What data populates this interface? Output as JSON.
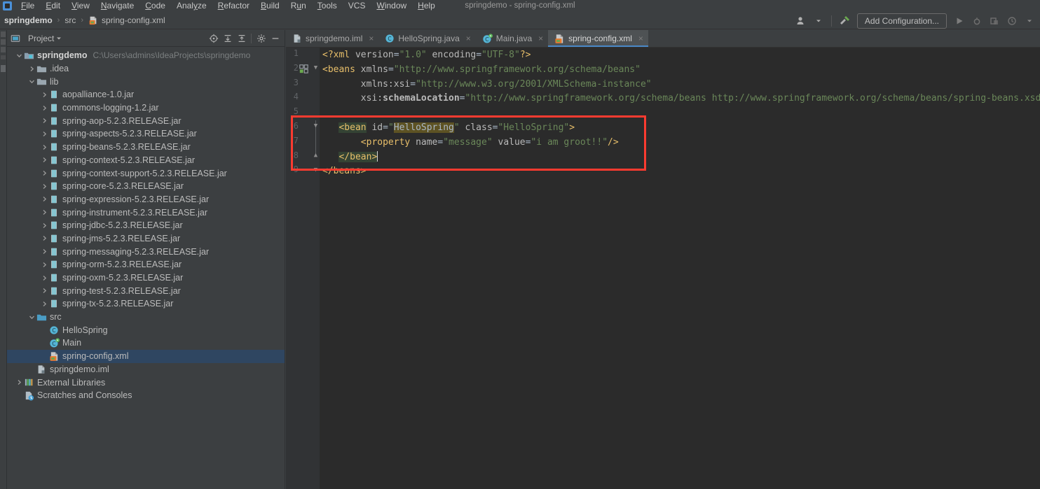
{
  "window": {
    "title": "springdemo - spring-config.xml"
  },
  "menu": {
    "items": [
      {
        "label": "File",
        "mnemonic": "F"
      },
      {
        "label": "Edit",
        "mnemonic": "E"
      },
      {
        "label": "View",
        "mnemonic": "V"
      },
      {
        "label": "Navigate",
        "mnemonic": "N"
      },
      {
        "label": "Code",
        "mnemonic": "C"
      },
      {
        "label": "Analyze",
        "mnemonic": "y"
      },
      {
        "label": "Refactor",
        "mnemonic": "R"
      },
      {
        "label": "Build",
        "mnemonic": "B"
      },
      {
        "label": "Run",
        "mnemonic": "u"
      },
      {
        "label": "Tools",
        "mnemonic": "T"
      },
      {
        "label": "VCS",
        "mnemonic": ""
      },
      {
        "label": "Window",
        "mnemonic": "W"
      },
      {
        "label": "Help",
        "mnemonic": "H"
      }
    ]
  },
  "navbar": {
    "crumbs": [
      {
        "label": "springdemo",
        "icon": ""
      },
      {
        "label": "src",
        "icon": ""
      },
      {
        "label": "spring-config.xml",
        "icon": "xml-file-icon"
      }
    ],
    "separator": "›"
  },
  "toolbar": {
    "user_icon": "user-avatar-icon",
    "hammer_icon": "build-hammer-icon",
    "run_config_label": "Add Configuration...",
    "run_icon": "run-icon",
    "debug_icon": "debug-icon",
    "coverage_icon": "run-with-coverage-icon",
    "profile_icon": "profile-icon",
    "more_icon": "chevron-down-icon"
  },
  "project_panel": {
    "title": "Project",
    "title_icon": "project-view-icon",
    "dropdown_icon": "chevron-down-icon",
    "header_buttons": [
      {
        "name": "scroll-from-source-icon"
      },
      {
        "name": "expand-all-icon"
      },
      {
        "name": "collapse-all-icon"
      },
      {
        "name": "settings-gear-icon"
      },
      {
        "name": "hide-panel-icon"
      }
    ],
    "tree": [
      {
        "label": "springdemo",
        "path": "C:\\Users\\admins\\IdeaProjects\\springdemo",
        "icon": "module-icon",
        "indent": 0,
        "arrow": "expanded",
        "bold": true,
        "selected": false
      },
      {
        "label": ".idea",
        "path": "",
        "icon": "folder-icon",
        "indent": 1,
        "arrow": "collapsed",
        "bold": false,
        "selected": false
      },
      {
        "label": "lib",
        "path": "",
        "icon": "folder-icon",
        "indent": 1,
        "arrow": "expanded",
        "bold": false,
        "selected": false
      },
      {
        "label": "aopalliance-1.0.jar",
        "path": "",
        "icon": "jar-icon",
        "indent": 2,
        "arrow": "collapsed",
        "bold": false,
        "selected": false
      },
      {
        "label": "commons-logging-1.2.jar",
        "path": "",
        "icon": "jar-icon",
        "indent": 2,
        "arrow": "collapsed",
        "bold": false,
        "selected": false
      },
      {
        "label": "spring-aop-5.2.3.RELEASE.jar",
        "path": "",
        "icon": "jar-icon",
        "indent": 2,
        "arrow": "collapsed",
        "bold": false,
        "selected": false
      },
      {
        "label": "spring-aspects-5.2.3.RELEASE.jar",
        "path": "",
        "icon": "jar-icon",
        "indent": 2,
        "arrow": "collapsed",
        "bold": false,
        "selected": false
      },
      {
        "label": "spring-beans-5.2.3.RELEASE.jar",
        "path": "",
        "icon": "jar-icon",
        "indent": 2,
        "arrow": "collapsed",
        "bold": false,
        "selected": false
      },
      {
        "label": "spring-context-5.2.3.RELEASE.jar",
        "path": "",
        "icon": "jar-icon",
        "indent": 2,
        "arrow": "collapsed",
        "bold": false,
        "selected": false
      },
      {
        "label": "spring-context-support-5.2.3.RELEASE.jar",
        "path": "",
        "icon": "jar-icon",
        "indent": 2,
        "arrow": "collapsed",
        "bold": false,
        "selected": false
      },
      {
        "label": "spring-core-5.2.3.RELEASE.jar",
        "path": "",
        "icon": "jar-icon",
        "indent": 2,
        "arrow": "collapsed",
        "bold": false,
        "selected": false
      },
      {
        "label": "spring-expression-5.2.3.RELEASE.jar",
        "path": "",
        "icon": "jar-icon",
        "indent": 2,
        "arrow": "collapsed",
        "bold": false,
        "selected": false
      },
      {
        "label": "spring-instrument-5.2.3.RELEASE.jar",
        "path": "",
        "icon": "jar-icon",
        "indent": 2,
        "arrow": "collapsed",
        "bold": false,
        "selected": false
      },
      {
        "label": "spring-jdbc-5.2.3.RELEASE.jar",
        "path": "",
        "icon": "jar-icon",
        "indent": 2,
        "arrow": "collapsed",
        "bold": false,
        "selected": false
      },
      {
        "label": "spring-jms-5.2.3.RELEASE.jar",
        "path": "",
        "icon": "jar-icon",
        "indent": 2,
        "arrow": "collapsed",
        "bold": false,
        "selected": false
      },
      {
        "label": "spring-messaging-5.2.3.RELEASE.jar",
        "path": "",
        "icon": "jar-icon",
        "indent": 2,
        "arrow": "collapsed",
        "bold": false,
        "selected": false
      },
      {
        "label": "spring-orm-5.2.3.RELEASE.jar",
        "path": "",
        "icon": "jar-icon",
        "indent": 2,
        "arrow": "collapsed",
        "bold": false,
        "selected": false
      },
      {
        "label": "spring-oxm-5.2.3.RELEASE.jar",
        "path": "",
        "icon": "jar-icon",
        "indent": 2,
        "arrow": "collapsed",
        "bold": false,
        "selected": false
      },
      {
        "label": "spring-test-5.2.3.RELEASE.jar",
        "path": "",
        "icon": "jar-icon",
        "indent": 2,
        "arrow": "collapsed",
        "bold": false,
        "selected": false
      },
      {
        "label": "spring-tx-5.2.3.RELEASE.jar",
        "path": "",
        "icon": "jar-icon",
        "indent": 2,
        "arrow": "collapsed",
        "bold": false,
        "selected": false
      },
      {
        "label": "src",
        "path": "",
        "icon": "source-folder-icon",
        "indent": 1,
        "arrow": "expanded",
        "bold": false,
        "selected": false
      },
      {
        "label": "HelloSpring",
        "path": "",
        "icon": "java-class-icon",
        "indent": 2,
        "arrow": "none",
        "bold": false,
        "selected": false
      },
      {
        "label": "Main",
        "path": "",
        "icon": "java-main-class-icon",
        "indent": 2,
        "arrow": "none",
        "bold": false,
        "selected": false
      },
      {
        "label": "spring-config.xml",
        "path": "",
        "icon": "xml-file-icon",
        "indent": 2,
        "arrow": "none",
        "bold": false,
        "selected": true
      },
      {
        "label": "springdemo.iml",
        "path": "",
        "icon": "iml-file-icon",
        "indent": 1,
        "arrow": "none",
        "bold": false,
        "selected": false
      },
      {
        "label": "External Libraries",
        "path": "",
        "icon": "libraries-icon",
        "indent": 0,
        "arrow": "collapsed",
        "bold": false,
        "selected": false
      },
      {
        "label": "Scratches and Consoles",
        "path": "",
        "icon": "scratches-icon",
        "indent": 0,
        "arrow": "none",
        "bold": false,
        "selected": false
      }
    ]
  },
  "editor": {
    "tabs": [
      {
        "label": "springdemo.iml",
        "icon": "iml-file-icon",
        "active": false
      },
      {
        "label": "HelloSpring.java",
        "icon": "java-class-icon",
        "active": false
      },
      {
        "label": "Main.java",
        "icon": "java-main-class-icon",
        "active": false
      },
      {
        "label": "spring-config.xml",
        "icon": "xml-file-icon",
        "active": true
      }
    ],
    "close_glyph": "×",
    "line_numbers": [
      "1",
      "2",
      "3",
      "4",
      "5",
      "6",
      "7",
      "8",
      "9"
    ],
    "lines": [
      {
        "n": 1,
        "segments": [
          {
            "t": "<?xml ",
            "c": "tag"
          },
          {
            "t": "version",
            "c": "attr"
          },
          {
            "t": "=",
            "c": "punct"
          },
          {
            "t": "\"1.0\"",
            "c": "str"
          },
          {
            "t": " encoding",
            "c": "attr"
          },
          {
            "t": "=",
            "c": "punct"
          },
          {
            "t": "\"UTF-8\"",
            "c": "str"
          },
          {
            "t": "?>",
            "c": "tag"
          }
        ]
      },
      {
        "n": 2,
        "segments": [
          {
            "t": "<beans ",
            "c": "tag"
          },
          {
            "t": "xmlns",
            "c": "attr"
          },
          {
            "t": "=",
            "c": "punct"
          },
          {
            "t": "\"http://www.springframework.org/schema/beans\"",
            "c": "str"
          }
        ]
      },
      {
        "n": 3,
        "segments": [
          {
            "t": "       xmlns:xsi",
            "c": "attr"
          },
          {
            "t": "=",
            "c": "punct"
          },
          {
            "t": "\"http://www.w3.org/2001/XMLSchema-instance\"",
            "c": "str"
          }
        ]
      },
      {
        "n": 4,
        "segments": [
          {
            "t": "       xsi:",
            "c": "attr"
          },
          {
            "t": "schemaLocation",
            "c": "attr-bold"
          },
          {
            "t": "=",
            "c": "punct"
          },
          {
            "t": "\"http://www.springframework.org/schema/beans http://www.springframework.org/schema/beans/spring-beans.xsd\"",
            "c": "str"
          },
          {
            "t": ">",
            "c": "tag"
          }
        ]
      },
      {
        "n": 5,
        "segments": []
      },
      {
        "n": 6,
        "segments": [
          {
            "t": "   ",
            "c": "punct"
          },
          {
            "t": "<bean",
            "c": "hl-tag"
          },
          {
            "t": " id",
            "c": "attr"
          },
          {
            "t": "=",
            "c": "punct"
          },
          {
            "t": "\"",
            "c": "str"
          },
          {
            "t": "HelloSpring",
            "c": "hl-val"
          },
          {
            "t": "\"",
            "c": "str"
          },
          {
            "t": " class",
            "c": "attr"
          },
          {
            "t": "=",
            "c": "punct"
          },
          {
            "t": "\"HelloSpring\"",
            "c": "str"
          },
          {
            "t": ">",
            "c": "tag"
          }
        ]
      },
      {
        "n": 7,
        "segments": [
          {
            "t": "       ",
            "c": "punct"
          },
          {
            "t": "<property ",
            "c": "tag"
          },
          {
            "t": "name",
            "c": "attr"
          },
          {
            "t": "=",
            "c": "punct"
          },
          {
            "t": "\"message\"",
            "c": "str"
          },
          {
            "t": " value",
            "c": "attr"
          },
          {
            "t": "=",
            "c": "punct"
          },
          {
            "t": "\"i am groot!!\"",
            "c": "str"
          },
          {
            "t": "/>",
            "c": "tag"
          }
        ]
      },
      {
        "n": 8,
        "segments": [
          {
            "t": "   ",
            "c": "punct"
          },
          {
            "t": "</bean>",
            "c": "hl-tag"
          },
          {
            "t": "CARET",
            "c": "caret"
          }
        ]
      },
      {
        "n": 9,
        "segments": [
          {
            "t": "</beans>",
            "c": "tag"
          }
        ]
      }
    ],
    "annotation": {
      "name": "red-highlight-box",
      "color": "#fe3b30"
    }
  },
  "colors": {
    "chrome": "#3c3f41",
    "editor_bg": "#2b2b2b",
    "gutter_bg": "#313335",
    "selection": "#2f4661",
    "tab_active": "#4e5254",
    "accent_blue": "#4a88c7",
    "string_green": "#6a8759",
    "tag_yellow": "#e8bf6a",
    "annotation_red": "#fe3b30"
  }
}
